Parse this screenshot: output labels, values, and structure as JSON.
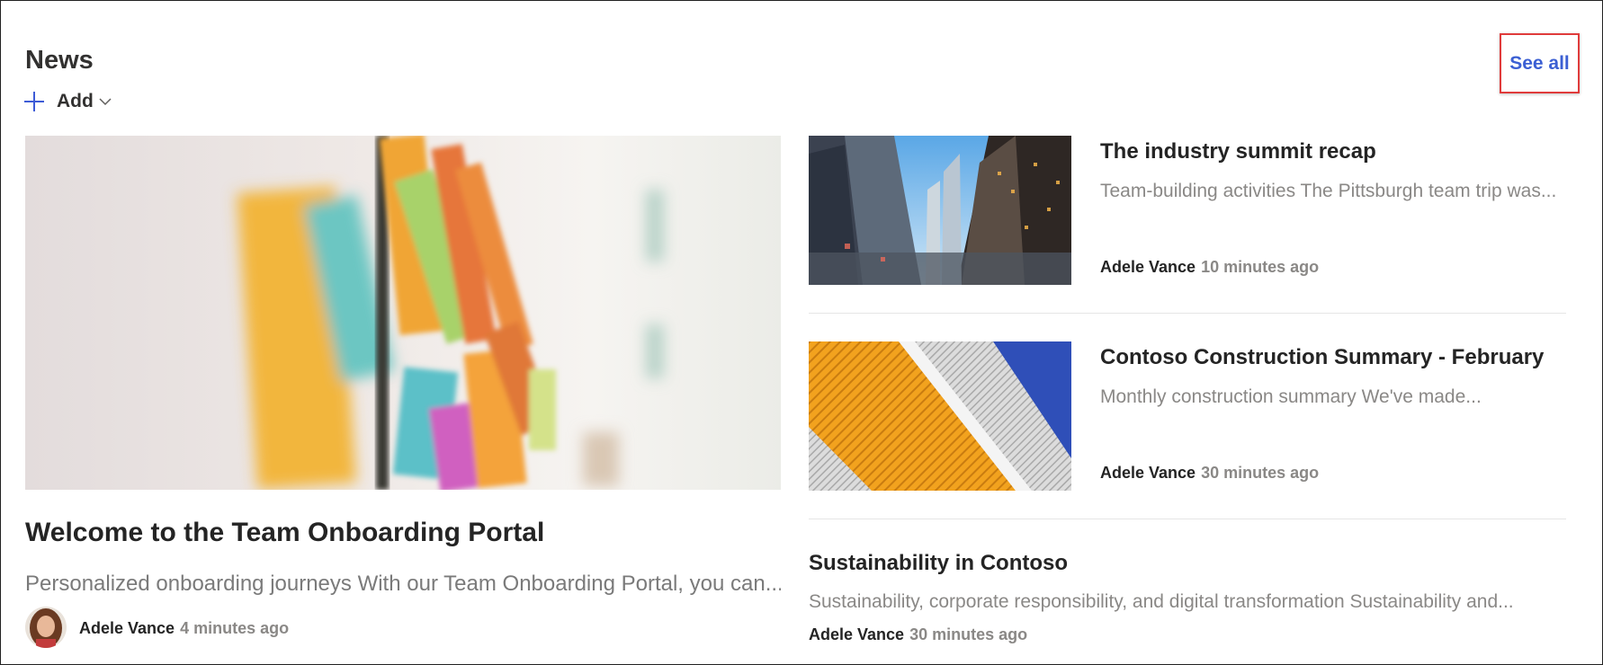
{
  "header": {
    "title": "News",
    "add_label": "Add",
    "see_all_label": "See all",
    "accent_color": "#3b5fd3",
    "highlight_color": "#e03b3b"
  },
  "hero": {
    "title": "Welcome to the Team Onboarding Portal",
    "description": "Personalized onboarding journeys With our Team Onboarding Portal, you can...",
    "author": "Adele Vance",
    "time": "4 minutes ago"
  },
  "items": [
    {
      "title": "The industry summit recap",
      "description": "Team-building activities The Pittsburgh team trip was...",
      "author": "Adele Vance",
      "time": "10 minutes ago"
    },
    {
      "title": "Contoso Construction Summary - February",
      "description": "Monthly construction summary We've made...",
      "author": "Adele Vance",
      "time": "30 minutes ago"
    },
    {
      "title": "Sustainability in Contoso",
      "description": "Sustainability, corporate responsibility, and digital transformation Sustainability and...",
      "author": "Adele Vance",
      "time": "30 minutes ago"
    }
  ],
  "icons": {
    "add": "plus-icon",
    "add_dropdown": "chevron-down-icon"
  }
}
